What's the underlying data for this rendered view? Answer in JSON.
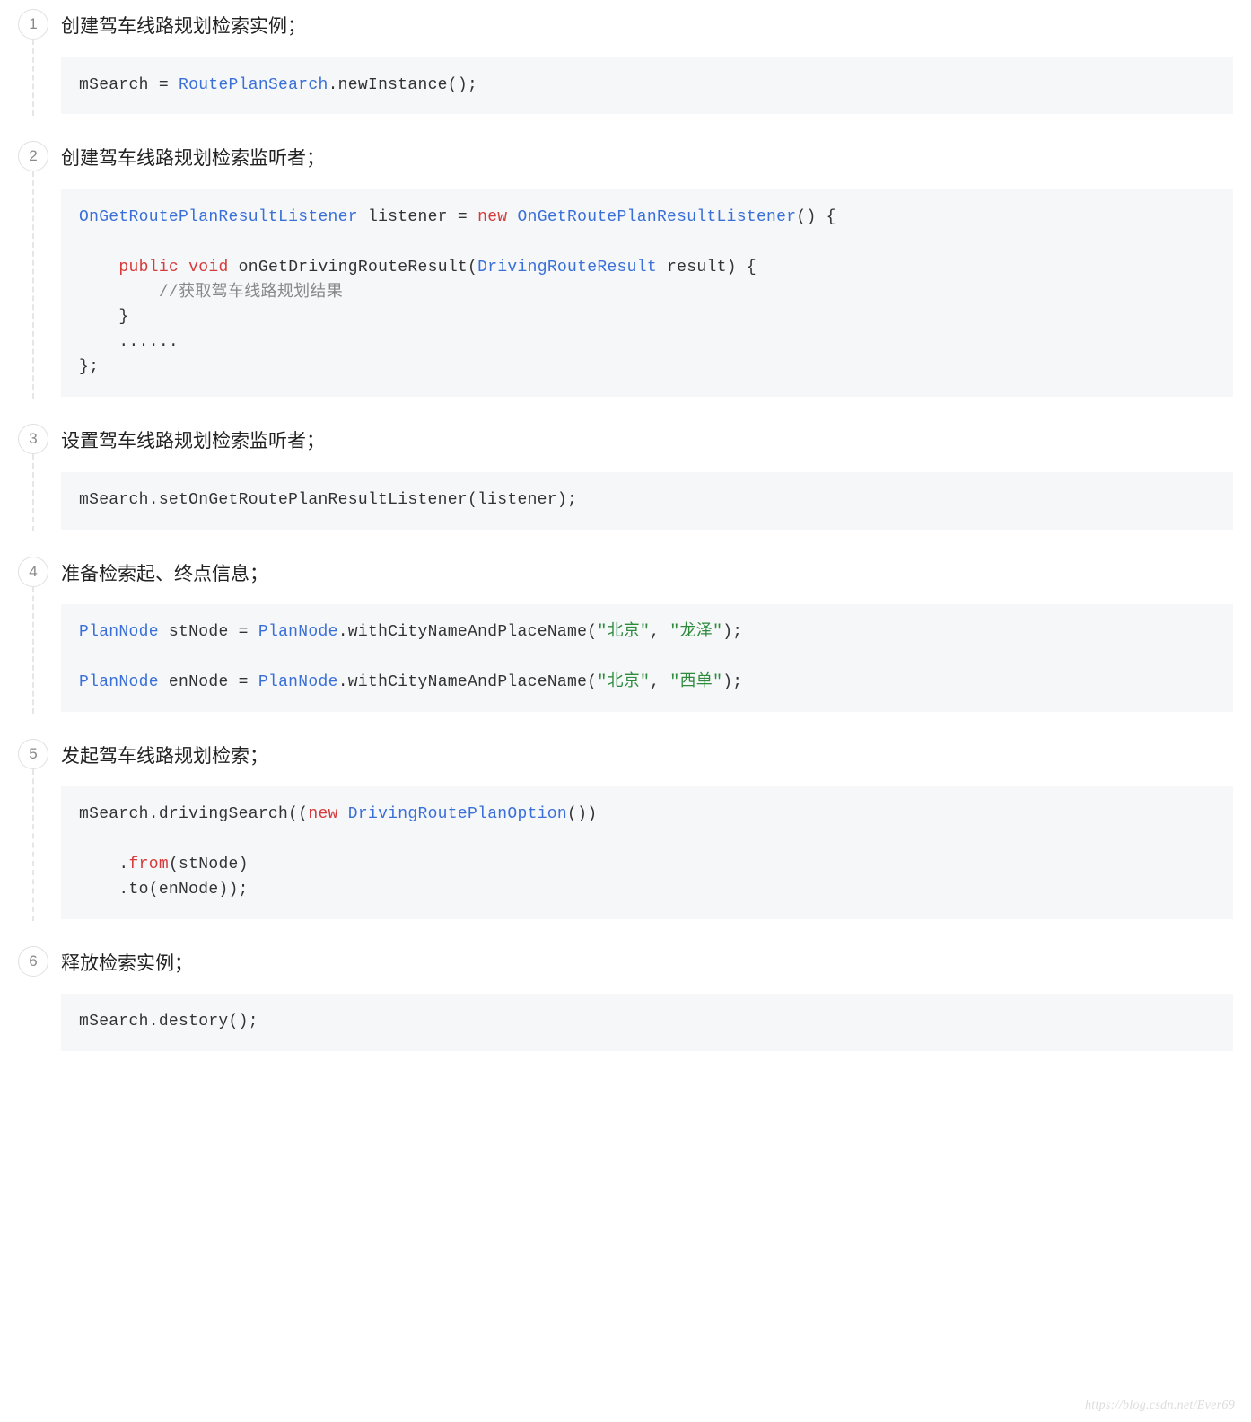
{
  "steps": [
    {
      "num": "1",
      "title": "创建驾车线路规划检索实例；",
      "code": [
        [
          {
            "t": "mSearch = ",
            "c": ""
          },
          {
            "t": "RoutePlanSearch",
            "c": "tk-type"
          },
          {
            "t": ".newInstance();",
            "c": ""
          }
        ]
      ]
    },
    {
      "num": "2",
      "title": "创建驾车线路规划检索监听者；",
      "code": [
        [
          {
            "t": "OnGetRoutePlanResultListener",
            "c": "tk-type"
          },
          {
            "t": " listener = ",
            "c": ""
          },
          {
            "t": "new",
            "c": "tk-kw"
          },
          {
            "t": " ",
            "c": ""
          },
          {
            "t": "OnGetRoutePlanResultListener",
            "c": "tk-type"
          },
          {
            "t": "() {",
            "c": ""
          }
        ],
        [],
        [
          {
            "t": "    ",
            "c": ""
          },
          {
            "t": "public",
            "c": "tk-kw"
          },
          {
            "t": " ",
            "c": ""
          },
          {
            "t": "void",
            "c": "tk-kw"
          },
          {
            "t": " onGetDrivingRouteResult(",
            "c": ""
          },
          {
            "t": "DrivingRouteResult",
            "c": "tk-type"
          },
          {
            "t": " result) {",
            "c": ""
          }
        ],
        [
          {
            "t": "        ",
            "c": ""
          },
          {
            "t": "//获取驾车线路规划结果",
            "c": "tk-cmt"
          }
        ],
        [
          {
            "t": "    }",
            "c": ""
          }
        ],
        [
          {
            "t": "    ......",
            "c": ""
          }
        ],
        [
          {
            "t": "};",
            "c": ""
          }
        ]
      ]
    },
    {
      "num": "3",
      "title": "设置驾车线路规划检索监听者；",
      "code": [
        [
          {
            "t": "mSearch.setOnGetRoutePlanResultListener(listener);",
            "c": ""
          }
        ]
      ]
    },
    {
      "num": "4",
      "title": "准备检索起、终点信息；",
      "code": [
        [
          {
            "t": "PlanNode",
            "c": "tk-type"
          },
          {
            "t": " stNode = ",
            "c": ""
          },
          {
            "t": "PlanNode",
            "c": "tk-type"
          },
          {
            "t": ".withCityNameAndPlaceName(",
            "c": ""
          },
          {
            "t": "\"北京\"",
            "c": "tk-str"
          },
          {
            "t": ", ",
            "c": ""
          },
          {
            "t": "\"龙泽\"",
            "c": "tk-str"
          },
          {
            "t": ");",
            "c": ""
          }
        ],
        [],
        [
          {
            "t": "PlanNode",
            "c": "tk-type"
          },
          {
            "t": " enNode = ",
            "c": ""
          },
          {
            "t": "PlanNode",
            "c": "tk-type"
          },
          {
            "t": ".withCityNameAndPlaceName(",
            "c": ""
          },
          {
            "t": "\"北京\"",
            "c": "tk-str"
          },
          {
            "t": ", ",
            "c": ""
          },
          {
            "t": "\"西单\"",
            "c": "tk-str"
          },
          {
            "t": ");",
            "c": ""
          }
        ]
      ]
    },
    {
      "num": "5",
      "title": "发起驾车线路规划检索；",
      "code": [
        [
          {
            "t": "mSearch.drivingSearch((",
            "c": ""
          },
          {
            "t": "new",
            "c": "tk-kw"
          },
          {
            "t": " ",
            "c": ""
          },
          {
            "t": "DrivingRoutePlanOption",
            "c": "tk-type"
          },
          {
            "t": "())",
            "c": ""
          }
        ],
        [],
        [
          {
            "t": "    .",
            "c": ""
          },
          {
            "t": "from",
            "c": "tk-kw"
          },
          {
            "t": "(stNode)",
            "c": ""
          }
        ],
        [
          {
            "t": "    .to(enNode));",
            "c": ""
          }
        ]
      ]
    },
    {
      "num": "6",
      "title": "释放检索实例；",
      "code": [
        [
          {
            "t": "mSearch.destory();",
            "c": ""
          }
        ]
      ]
    }
  ],
  "footer": "https://blog.csdn.net/Ever69"
}
